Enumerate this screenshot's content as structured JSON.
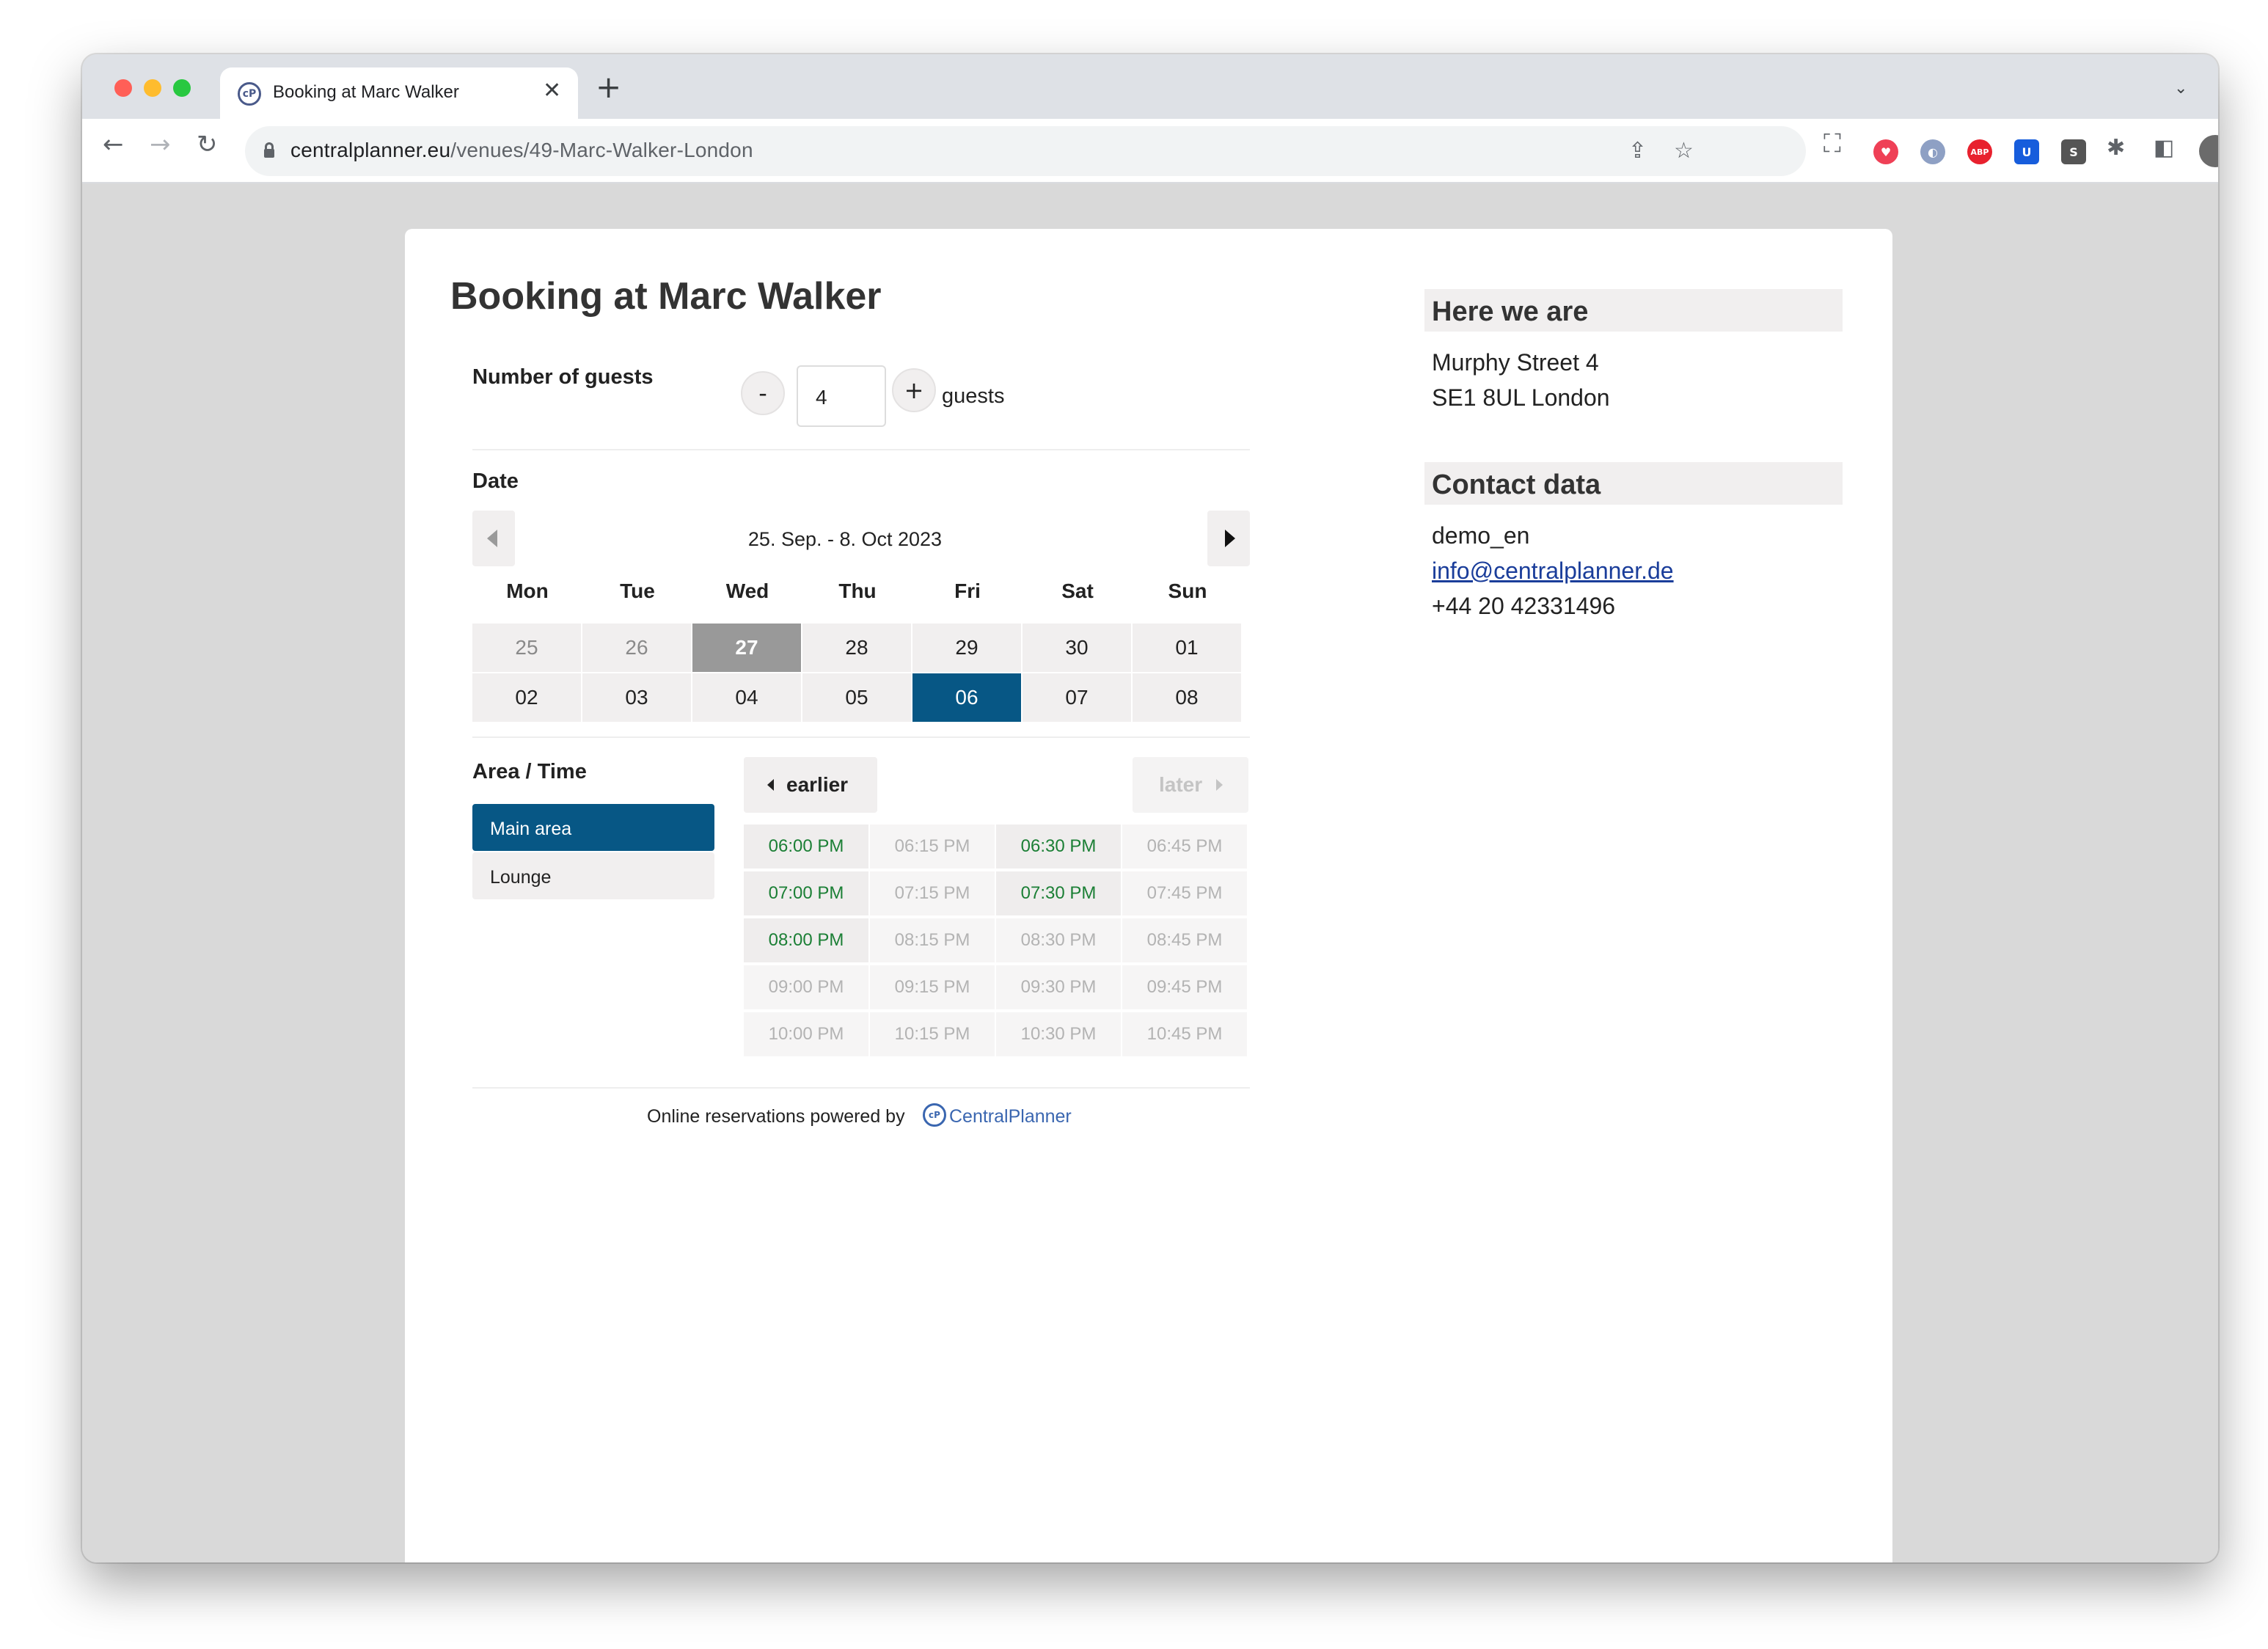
{
  "browser": {
    "tab_title": "Booking at Marc Walker",
    "tab_favicon_text": "cP",
    "url_domain": "centralplanner.eu",
    "url_path": "/venues/49-Marc-Walker-London",
    "extensions": [
      {
        "name": "pocket-icon",
        "color": "#ef4056"
      },
      {
        "name": "abp-icon",
        "label": "ABP",
        "color": "#e8212e"
      },
      {
        "name": "bitwarden-icon",
        "label": "U",
        "color": "#175ddc"
      },
      {
        "name": "s-extension-icon",
        "label": "S",
        "color": "#555555"
      }
    ]
  },
  "page": {
    "title": "Booking at Marc Walker",
    "guests": {
      "label": "Number of guests",
      "minus_label": "-",
      "value": "4",
      "plus_label": "+",
      "unit": "guests"
    },
    "date": {
      "label": "Date",
      "range": "25. Sep. - 8. Oct 2023",
      "weekdays": [
        "Mon",
        "Tue",
        "Wed",
        "Thu",
        "Fri",
        "Sat",
        "Sun"
      ],
      "weeks": [
        [
          {
            "day": "25",
            "state": "past"
          },
          {
            "day": "26",
            "state": "past"
          },
          {
            "day": "27",
            "state": "today"
          },
          {
            "day": "28",
            "state": "normal"
          },
          {
            "day": "29",
            "state": "normal"
          },
          {
            "day": "30",
            "state": "normal"
          },
          {
            "day": "01",
            "state": "normal"
          }
        ],
        [
          {
            "day": "02",
            "state": "normal"
          },
          {
            "day": "03",
            "state": "normal"
          },
          {
            "day": "04",
            "state": "normal"
          },
          {
            "day": "05",
            "state": "normal"
          },
          {
            "day": "06",
            "state": "selected"
          },
          {
            "day": "07",
            "state": "normal"
          },
          {
            "day": "08",
            "state": "normal"
          }
        ]
      ]
    },
    "area_time": {
      "label": "Area / Time",
      "areas": [
        {
          "name": "Main area",
          "active": true
        },
        {
          "name": "Lounge",
          "active": false
        }
      ],
      "earlier_label": "earlier",
      "later_label": "later",
      "slots": [
        [
          {
            "time": "06:00 PM",
            "available": true
          },
          {
            "time": "06:15 PM",
            "available": false
          },
          {
            "time": "06:30 PM",
            "available": true
          },
          {
            "time": "06:45 PM",
            "available": false
          }
        ],
        [
          {
            "time": "07:00 PM",
            "available": true
          },
          {
            "time": "07:15 PM",
            "available": false
          },
          {
            "time": "07:30 PM",
            "available": true
          },
          {
            "time": "07:45 PM",
            "available": false
          }
        ],
        [
          {
            "time": "08:00 PM",
            "available": true
          },
          {
            "time": "08:15 PM",
            "available": false
          },
          {
            "time": "08:30 PM",
            "available": false
          },
          {
            "time": "08:45 PM",
            "available": false
          }
        ],
        [
          {
            "time": "09:00 PM",
            "available": false
          },
          {
            "time": "09:15 PM",
            "available": false
          },
          {
            "time": "09:30 PM",
            "available": false
          },
          {
            "time": "09:45 PM",
            "available": false
          }
        ],
        [
          {
            "time": "10:00 PM",
            "available": false
          },
          {
            "time": "10:15 PM",
            "available": false
          },
          {
            "time": "10:30 PM",
            "available": false
          },
          {
            "time": "10:45 PM",
            "available": false
          }
        ]
      ]
    },
    "footer": {
      "text": "Online reservations powered by",
      "logo_text": "cP",
      "brand": "CentralPlanner"
    }
  },
  "sidebar": {
    "location_heading": "Here we are",
    "address_line1": "Murphy Street 4",
    "address_line2": "SE1 8UL London",
    "contact_heading": "Contact data",
    "contact_name": "demo_en",
    "contact_email": "info@centralplanner.de",
    "contact_phone": "+44 20 42331496"
  },
  "colors": {
    "selected": "#075785",
    "today": "#999999",
    "available_time": "#1b7f35",
    "cell_bg": "#f1efef"
  }
}
